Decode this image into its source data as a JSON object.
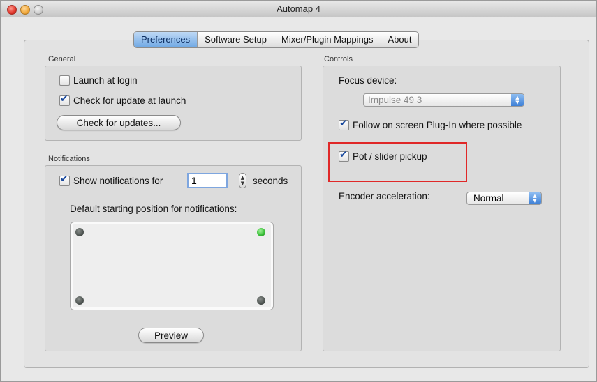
{
  "window": {
    "title": "Automap 4"
  },
  "tabs": [
    {
      "label": "Preferences",
      "active": true
    },
    {
      "label": "Software Setup",
      "active": false
    },
    {
      "label": "Mixer/Plugin Mappings",
      "active": false
    },
    {
      "label": "About",
      "active": false
    }
  ],
  "general": {
    "section_label": "General",
    "launch_at_login": {
      "label": "Launch at login",
      "checked": false
    },
    "check_update_at_launch": {
      "label": "Check for update at launch",
      "checked": true
    },
    "check_updates_button": "Check for updates..."
  },
  "notifications": {
    "section_label": "Notifications",
    "show_notifications": {
      "label": "Show notifications for",
      "checked": true
    },
    "seconds_value": "1",
    "seconds_label": "seconds",
    "position_label": "Default starting position for notifications:",
    "selected_position": "top-right",
    "preview_button": "Preview"
  },
  "controls": {
    "section_label": "Controls",
    "focus_device_label": "Focus device:",
    "focus_device_value": "Impulse 49  3",
    "follow_plugin": {
      "label": "Follow on screen Plug-In where possible",
      "checked": true
    },
    "pot_slider_pickup": {
      "label": "Pot / slider pickup",
      "checked": true
    },
    "encoder_accel_label": "Encoder acceleration:",
    "encoder_accel_value": "Normal"
  },
  "colors": {
    "highlight": "#e02828",
    "active_tab": "#6fa8e4",
    "selected_dot": "#3bbf3a"
  }
}
